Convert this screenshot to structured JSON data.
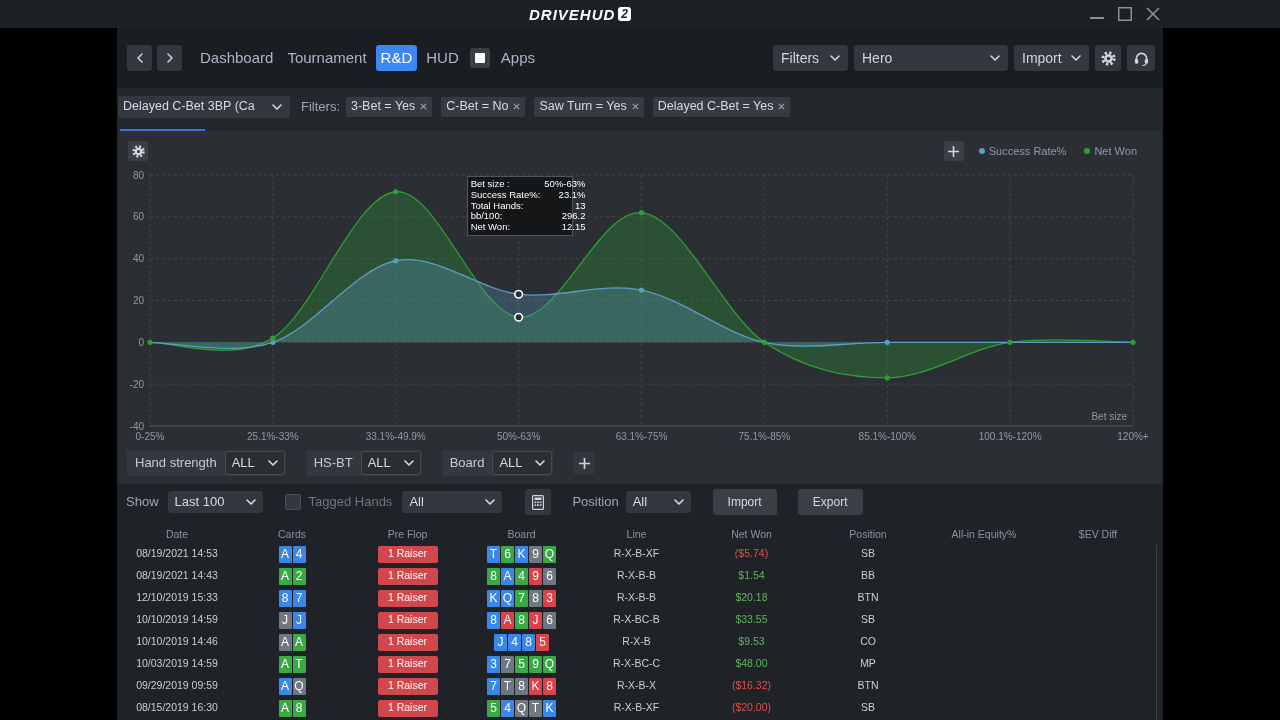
{
  "title_bar": {
    "logo": "DRIVEHUD",
    "logo_badge": "2"
  },
  "nav": {
    "tabs": [
      {
        "label": "Dashboard",
        "selected": false
      },
      {
        "label": "Tournament",
        "selected": false
      },
      {
        "label": "R&D",
        "selected": true
      },
      {
        "label": "HUD",
        "selected": false,
        "toggle": {
          "on": true
        }
      },
      {
        "label": "Apps",
        "selected": false
      }
    ],
    "filters_menu": "Filters",
    "player_select": "Hero",
    "import_menu": "Import"
  },
  "report_bar": {
    "report": "Delayed C-Bet 3BP (Ca",
    "filters_label": "Filters:",
    "filters": [
      "3-Bet = Yes",
      "C-Bet = No",
      "Saw Turn = Yes",
      "Delayed C-Bet = Yes"
    ]
  },
  "chart_panel": {
    "tooltip": [
      {
        "label": "Bet size :",
        "value": "50%-63%"
      },
      {
        "label": "Success Rate%:",
        "value": "23.1%"
      },
      {
        "label": "Total Hands:",
        "value": "13"
      },
      {
        "label": "bb/100:",
        "value": "296.2"
      },
      {
        "label": "Net Won:",
        "value": "12.15"
      }
    ],
    "hovered": [
      false,
      false,
      false,
      true,
      false,
      false,
      false,
      false,
      false
    ],
    "chart_data": {
      "type": "area",
      "categories": [
        "0-25%",
        "25.1%-33%",
        "33.1%-49.9%",
        "50%-63%",
        "63.1%-75%",
        "75.1%-85%",
        "85.1%-100%",
        "100.1%-120%",
        "120%+"
      ],
      "series": [
        {
          "name": "Success Rate%",
          "color": "#5b9dc5",
          "values": [
            0,
            0,
            39,
            23,
            25,
            0,
            0,
            0,
            0
          ]
        },
        {
          "name": "Net Won",
          "color": "#2e9e35",
          "values": [
            0,
            2,
            72,
            12,
            62,
            0,
            -17,
            0,
            0
          ]
        }
      ],
      "xlabel": "Bet size",
      "ylim": [
        -40,
        80
      ],
      "yticks": [
        -40,
        -20,
        0,
        20,
        40,
        60,
        80
      ],
      "grid": true
    }
  },
  "breakdown_filters": [
    {
      "label": "Hand strength",
      "value": "ALL"
    },
    {
      "label": "HS-BT",
      "value": "ALL"
    },
    {
      "label": "Board",
      "value": "ALL"
    }
  ],
  "hands_toolbar": {
    "show_label": "Show",
    "show_value": "Last 100",
    "tagged_hands": {
      "label": "Tagged Hands",
      "checked": false
    },
    "tag_filter": "All",
    "position_label": "Position",
    "position_value": "All",
    "buttons": [
      "Import",
      "Export"
    ]
  },
  "table": {
    "columns": [
      "Date",
      "Cards",
      "Pre Flop",
      "Board",
      "Line",
      "Net Won",
      "Position",
      "All-in Equity%",
      "$EV Diff"
    ],
    "rows": [
      {
        "date": "08/19/2021 14:53",
        "cards": [
          {
            "rank": "A",
            "color": "#3b86e6"
          },
          {
            "rank": "4",
            "color": "#3b86e6"
          }
        ],
        "pre_flop": "1 Raiser",
        "board": [
          {
            "rank": "T",
            "color": "#3b86e6"
          },
          {
            "rank": "6",
            "color": "#3aa845"
          },
          {
            "rank": "K",
            "color": "#3b86e6"
          },
          {
            "rank": "9",
            "color": "#6e7782"
          },
          {
            "rank": "Q",
            "color": "#3aa845"
          }
        ],
        "line": "R-X-B-XF",
        "net_won": {
          "text": "($5.74)",
          "color": "#d9534f"
        },
        "position": "SB"
      },
      {
        "date": "08/19/2021 14:43",
        "cards": [
          {
            "rank": "A",
            "color": "#3aa845"
          },
          {
            "rank": "2",
            "color": "#3aa845"
          }
        ],
        "pre_flop": "1 Raiser",
        "board": [
          {
            "rank": "8",
            "color": "#3aa845"
          },
          {
            "rank": "A",
            "color": "#3b86e6"
          },
          {
            "rank": "4",
            "color": "#3aa845"
          },
          {
            "rank": "9",
            "color": "#d8444a"
          },
          {
            "rank": "6",
            "color": "#6e7782"
          }
        ],
        "line": "R-X-B-B",
        "net_won": {
          "text": "$1.54",
          "color": "#5cb85c"
        },
        "position": "BB"
      },
      {
        "date": "12/10/2019 15:33",
        "cards": [
          {
            "rank": "8",
            "color": "#3b86e6"
          },
          {
            "rank": "7",
            "color": "#3b86e6"
          }
        ],
        "pre_flop": "1 Raiser",
        "board": [
          {
            "rank": "K",
            "color": "#3b86e6"
          },
          {
            "rank": "Q",
            "color": "#3b86e6"
          },
          {
            "rank": "7",
            "color": "#3aa845"
          },
          {
            "rank": "8",
            "color": "#6e7782"
          },
          {
            "rank": "3",
            "color": "#d8444a"
          }
        ],
        "line": "R-X-B-B",
        "net_won": {
          "text": "$20.18",
          "color": "#5cb85c"
        },
        "position": "BTN"
      },
      {
        "date": "10/10/2019 14:59",
        "cards": [
          {
            "rank": "J",
            "color": "#6e7782"
          },
          {
            "rank": "J",
            "color": "#3b86e6"
          }
        ],
        "pre_flop": "1 Raiser",
        "board": [
          {
            "rank": "8",
            "color": "#3b86e6"
          },
          {
            "rank": "A",
            "color": "#d8444a"
          },
          {
            "rank": "8",
            "color": "#3aa845"
          },
          {
            "rank": "J",
            "color": "#d8444a"
          },
          {
            "rank": "6",
            "color": "#6e7782"
          }
        ],
        "line": "R-X-BC-B",
        "net_won": {
          "text": "$33.55",
          "color": "#5cb85c"
        },
        "position": "SB"
      },
      {
        "date": "10/10/2019 14:46",
        "cards": [
          {
            "rank": "A",
            "color": "#6e7782"
          },
          {
            "rank": "A",
            "color": "#3aa845"
          }
        ],
        "pre_flop": "1 Raiser",
        "board": [
          {
            "rank": "J",
            "color": "#3b86e6"
          },
          {
            "rank": "4",
            "color": "#3b86e6"
          },
          {
            "rank": "8",
            "color": "#3b86e6"
          },
          {
            "rank": "5",
            "color": "#d8444a"
          }
        ],
        "line": "R-X-B",
        "net_won": {
          "text": "$9.53",
          "color": "#5cb85c"
        },
        "position": "CO"
      },
      {
        "date": "10/03/2019 14:59",
        "cards": [
          {
            "rank": "A",
            "color": "#3aa845"
          },
          {
            "rank": "T",
            "color": "#3aa845"
          }
        ],
        "pre_flop": "1 Raiser",
        "board": [
          {
            "rank": "3",
            "color": "#3b86e6"
          },
          {
            "rank": "7",
            "color": "#6e7782"
          },
          {
            "rank": "5",
            "color": "#3aa845"
          },
          {
            "rank": "9",
            "color": "#3aa845"
          },
          {
            "rank": "Q",
            "color": "#3aa845"
          }
        ],
        "line": "R-X-BC-C",
        "net_won": {
          "text": "$48.00",
          "color": "#5cb85c"
        },
        "position": "MP"
      },
      {
        "date": "09/29/2019 09:59",
        "cards": [
          {
            "rank": "A",
            "color": "#3b86e6"
          },
          {
            "rank": "Q",
            "color": "#6e7782"
          }
        ],
        "pre_flop": "1 Raiser",
        "board": [
          {
            "rank": "7",
            "color": "#3b86e6"
          },
          {
            "rank": "T",
            "color": "#6e7782"
          },
          {
            "rank": "8",
            "color": "#6e7782"
          },
          {
            "rank": "K",
            "color": "#d8444a"
          },
          {
            "rank": "8",
            "color": "#d8444a"
          }
        ],
        "line": "R-X-B-X",
        "net_won": {
          "text": "($16.32)",
          "color": "#d9534f"
        },
        "position": "BTN"
      },
      {
        "date": "08/15/2019 16:30",
        "cards": [
          {
            "rank": "A",
            "color": "#3aa845"
          },
          {
            "rank": "8",
            "color": "#3aa845"
          }
        ],
        "pre_flop": "1 Raiser",
        "board": [
          {
            "rank": "5",
            "color": "#3aa845"
          },
          {
            "rank": "4",
            "color": "#3b86e6"
          },
          {
            "rank": "Q",
            "color": "#6e7782"
          },
          {
            "rank": "T",
            "color": "#6e7782"
          },
          {
            "rank": "K",
            "color": "#3b86e6"
          }
        ],
        "line": "R-X-B-XF",
        "net_won": {
          "text": "($20.00)",
          "color": "#d9534f"
        },
        "position": "SB"
      }
    ]
  }
}
